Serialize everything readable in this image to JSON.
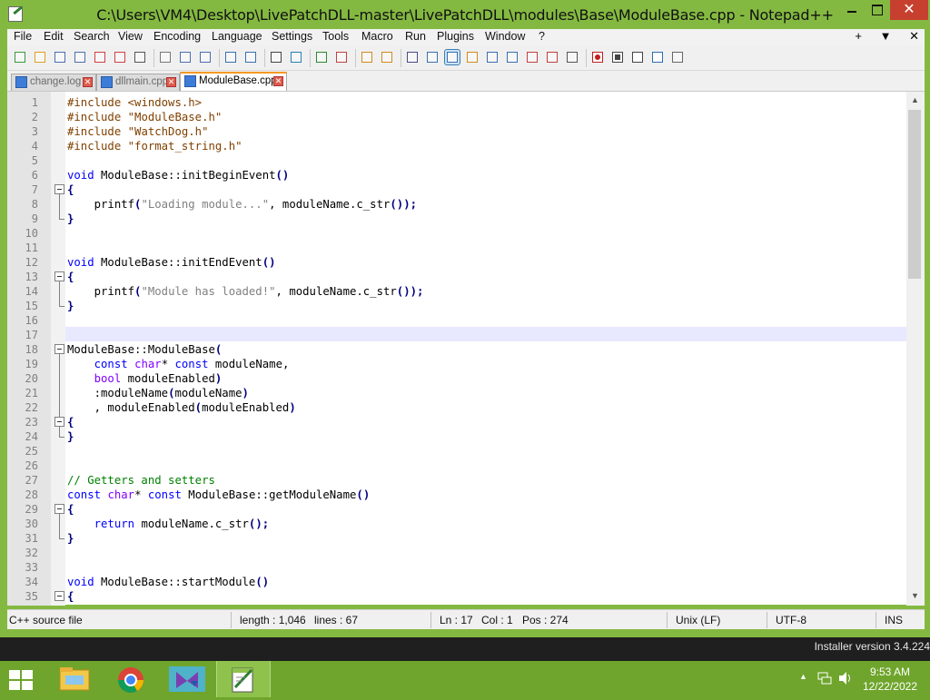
{
  "window": {
    "title": "C:\\Users\\VM4\\Desktop\\LivePatchDLL-master\\LivePatchDLL\\modules\\Base\\ModuleBase.cpp - Notepad++",
    "minimize_icon": "minimize-icon",
    "maximize_icon": "maximize-icon",
    "close_label": "✕"
  },
  "menu": {
    "items": [
      "File",
      "Edit",
      "Search",
      "View",
      "Encoding",
      "Language",
      "Settings",
      "Tools",
      "Macro",
      "Run",
      "Plugins",
      "Window",
      "?"
    ],
    "right": [
      "+",
      "▼",
      "✕"
    ]
  },
  "toolbar": {
    "icons": [
      "new-file-icon",
      "open-file-icon",
      "save-icon",
      "save-all-icon",
      "close-icon",
      "close-all-icon",
      "print-icon",
      "cut-icon",
      "copy-icon",
      "paste-icon",
      "undo-icon",
      "redo-icon",
      "find-icon",
      "replace-icon",
      "zoom-in-icon",
      "zoom-out-icon",
      "sync-vertical-icon",
      "sync-horizontal-icon",
      "word-wrap-icon",
      "show-all-chars-icon",
      "indent-guide-icon",
      "udl-icon",
      "doc-map-icon",
      "function-list-icon",
      "folder-workspace-icon",
      "doc-list-icon",
      "monitoring-icon",
      "record-macro-icon",
      "stop-record-icon",
      "play-macro-icon",
      "run-macro-multiple-icon",
      "save-macro-icon"
    ]
  },
  "tabs": [
    {
      "label": "change.log",
      "active": false
    },
    {
      "label": "dllmain.cpp",
      "active": false
    },
    {
      "label": "ModuleBase.cpp",
      "active": true
    }
  ],
  "editor": {
    "current_line": 17,
    "lines": [
      {
        "n": "1",
        "text": "#include <windows.h>"
      },
      {
        "n": "2",
        "text": "#include \"ModuleBase.h\""
      },
      {
        "n": "3",
        "text": "#include \"WatchDog.h\""
      },
      {
        "n": "4",
        "text": "#include \"format_string.h\""
      },
      {
        "n": "5",
        "text": ""
      },
      {
        "n": "6",
        "text": "void ModuleBase::initBeginEvent()"
      },
      {
        "n": "7",
        "text": "{"
      },
      {
        "n": "8",
        "text": "    printf(\"Loading module...\", moduleName.c_str());"
      },
      {
        "n": "9",
        "text": "}"
      },
      {
        "n": "10",
        "text": ""
      },
      {
        "n": "11",
        "text": ""
      },
      {
        "n": "12",
        "text": "void ModuleBase::initEndEvent()"
      },
      {
        "n": "13",
        "text": "{"
      },
      {
        "n": "14",
        "text": "    printf(\"Module has loaded!\", moduleName.c_str());"
      },
      {
        "n": "15",
        "text": "}"
      },
      {
        "n": "16",
        "text": ""
      },
      {
        "n": "17",
        "text": ""
      },
      {
        "n": "18",
        "text": "ModuleBase::ModuleBase("
      },
      {
        "n": "19",
        "text": "    const char* const moduleName,"
      },
      {
        "n": "20",
        "text": "    bool moduleEnabled)"
      },
      {
        "n": "21",
        "text": "    :moduleName(moduleName)"
      },
      {
        "n": "22",
        "text": "    , moduleEnabled(moduleEnabled)"
      },
      {
        "n": "23",
        "text": "{"
      },
      {
        "n": "24",
        "text": "}"
      },
      {
        "n": "25",
        "text": ""
      },
      {
        "n": "26",
        "text": ""
      },
      {
        "n": "27",
        "text": "// Getters and setters"
      },
      {
        "n": "28",
        "text": "const char* const ModuleBase::getModuleName()"
      },
      {
        "n": "29",
        "text": "{"
      },
      {
        "n": "30",
        "text": "    return moduleName.c_str();"
      },
      {
        "n": "31",
        "text": "}"
      },
      {
        "n": "32",
        "text": ""
      },
      {
        "n": "33",
        "text": ""
      },
      {
        "n": "34",
        "text": "void ModuleBase::startModule()"
      },
      {
        "n": "35",
        "text": "{"
      }
    ]
  },
  "status": {
    "language": "C++ source file",
    "length": "length : 1,046",
    "lines": "lines : 67",
    "ln": "Ln : 17",
    "col": "Col : 1",
    "pos": "Pos : 274",
    "eol": "Unix (LF)",
    "encoding": "UTF-8",
    "mode": "INS"
  },
  "installer": "Installer version 3.4.224",
  "taskbar": {
    "apps": [
      "file-explorer-icon",
      "chrome-icon",
      "visual-studio-icon",
      "notepad-plus-plus-icon"
    ],
    "time": "9:53 AM",
    "date": "12/22/2022"
  },
  "colors": {
    "title_bar": "#84b941",
    "taskbar": "#6fa52c",
    "close_button": "#c7402f",
    "active_tab_accent": "#f59a23",
    "keyword": "#0000ff",
    "type_keyword": "#8000ff",
    "string": "#808080",
    "comment": "#008000",
    "preprocessor": "#804000",
    "current_line": "#e8e8ff"
  }
}
